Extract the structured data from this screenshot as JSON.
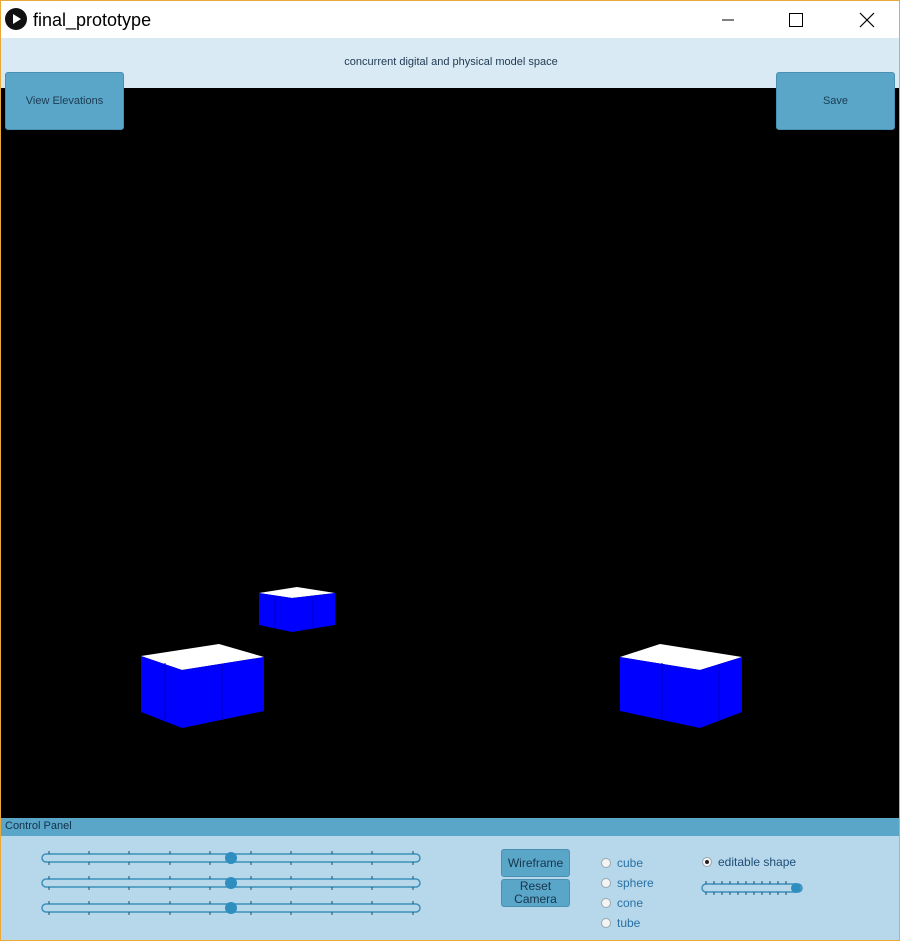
{
  "window": {
    "title": "final_prototype",
    "controls": [
      "minimize",
      "maximize",
      "close"
    ]
  },
  "header": {
    "title": "concurrent digital and physical model space"
  },
  "toolbar": {
    "view_elevations_label": "View Elevations",
    "save_label": "Save"
  },
  "viewport": {
    "background": "#000000",
    "shapes": [
      {
        "kind": "box",
        "face_color": "#0000ff",
        "top_color": "#ffffff"
      },
      {
        "kind": "box",
        "face_color": "#0000ff",
        "top_color": "#ffffff"
      },
      {
        "kind": "box",
        "face_color": "#0000ff",
        "top_color": "#ffffff"
      }
    ]
  },
  "control_panel": {
    "title": "Control Panel",
    "sliders": [
      {
        "name": "slider-1",
        "value": 0.5
      },
      {
        "name": "slider-2",
        "value": 0.5
      },
      {
        "name": "slider-3",
        "value": 0.5
      }
    ],
    "wireframe_label": "Wireframe",
    "reset_camera_label_line1": "Reset",
    "reset_camera_label_line2": "Camera",
    "shape_options": [
      {
        "label": "cube",
        "checked": false
      },
      {
        "label": "sphere",
        "checked": false
      },
      {
        "label": "cone",
        "checked": false
      },
      {
        "label": "tube",
        "checked": false
      }
    ],
    "editable_shape": {
      "label": "editable shape",
      "checked": true
    },
    "editable_slider_value": 1.0
  },
  "colors": {
    "accent": "#5aa6c8",
    "panel_bg": "#b6d8ea",
    "header_bg": "#daeaf4"
  }
}
